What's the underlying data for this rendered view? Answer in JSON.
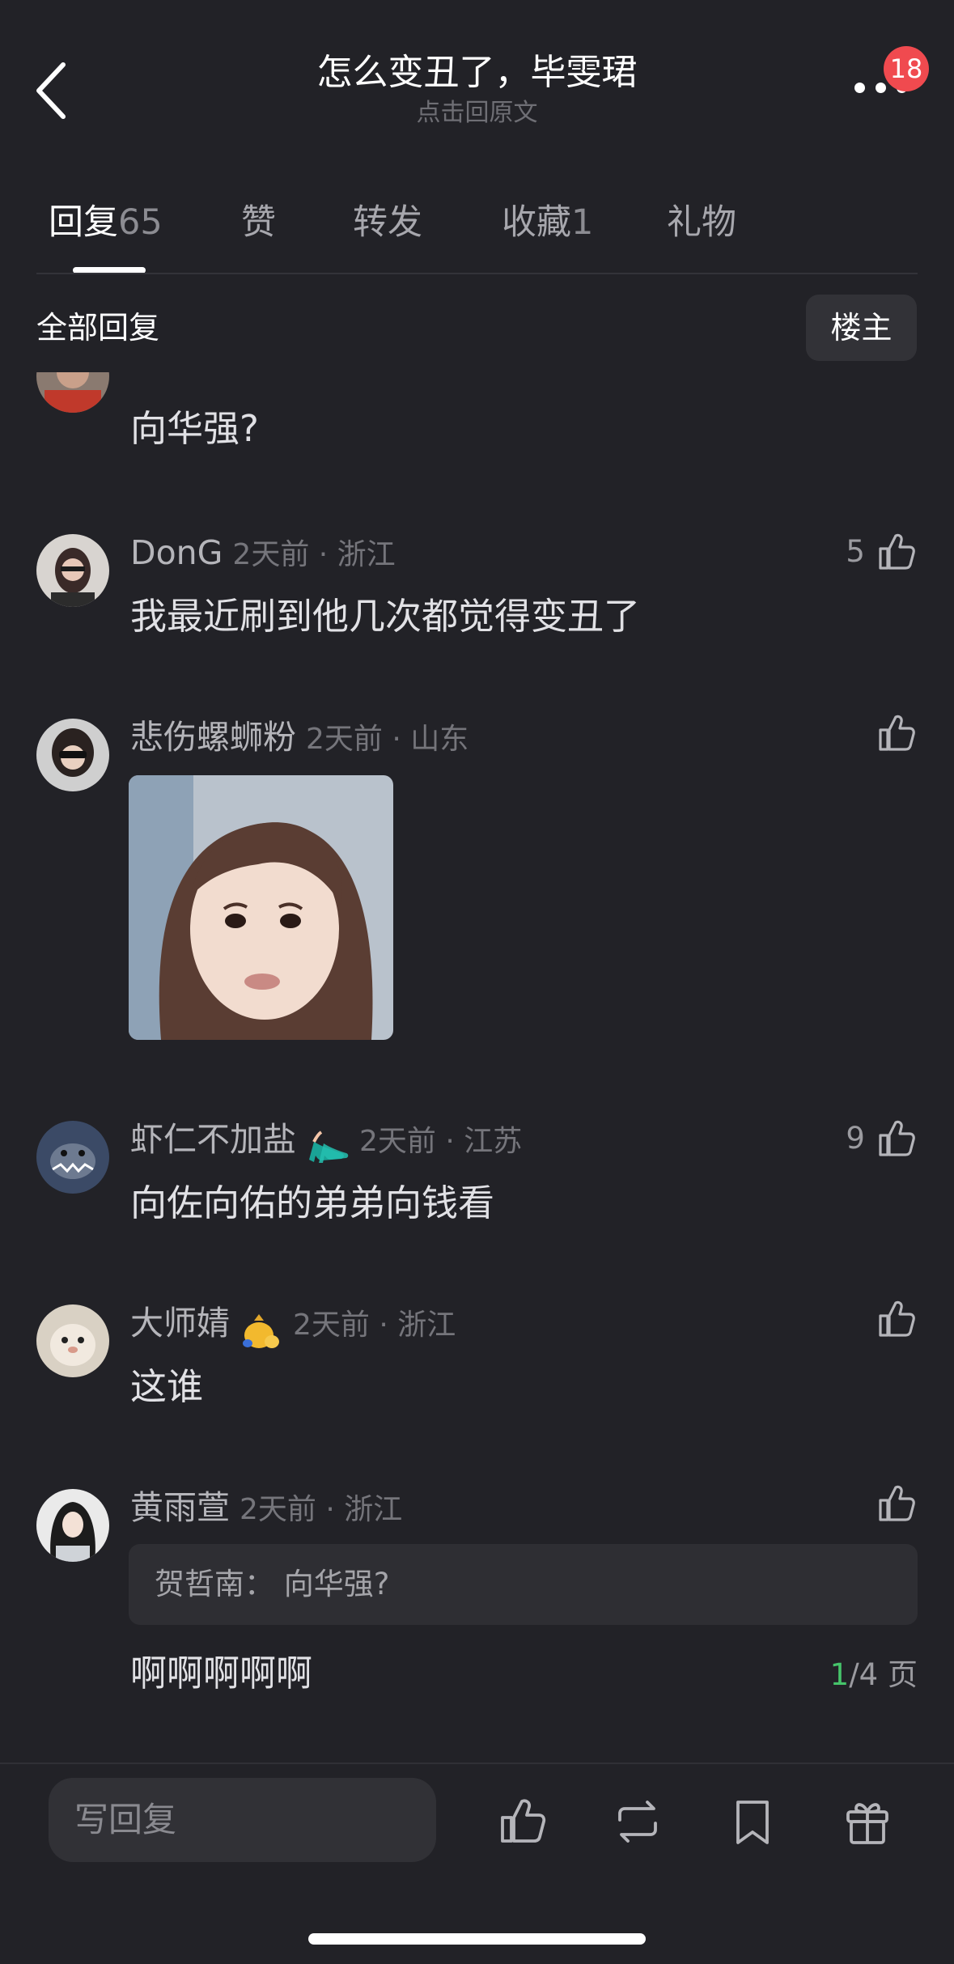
{
  "header": {
    "title": "怎么变丑了，毕雯珺",
    "subtitle": "点击回原文",
    "badge_count": "18",
    "back_icon": "chevron-left-icon",
    "more_icon": "more-dots-icon"
  },
  "tabs": [
    {
      "label": "回复",
      "count": "65"
    },
    {
      "label": "赞",
      "count": ""
    },
    {
      "label": "转发",
      "count": ""
    },
    {
      "label": "收藏",
      "count": "1"
    },
    {
      "label": "礼物",
      "count": ""
    }
  ],
  "filter": {
    "label": "全部回复",
    "owner_button": "楼主"
  },
  "comments": [
    {
      "text": "向华强?"
    },
    {
      "username": "DonG",
      "time": "2天前 · 浙江",
      "likes": "5",
      "text": "我最近刷到他几次都觉得变丑了"
    },
    {
      "username": "悲伤螺蛳粉",
      "time": "2天前 · 山东",
      "likes": "",
      "image": "reaction-photo"
    },
    {
      "username": "虾仁不加盐",
      "medal": "high-heels-icon",
      "time": "2天前 · 江苏",
      "likes": "9",
      "text": "向佐向佑的弟弟向钱看"
    },
    {
      "username": "大师婧",
      "medal": "money-bag-icon",
      "time": "2天前 · 浙江",
      "likes": "",
      "text": "这谁"
    },
    {
      "username": "黄雨萱",
      "time": "2天前 · 浙江",
      "likes": "",
      "quote": "贺哲南：  向华强?",
      "text": "啊啊啊啊啊"
    }
  ],
  "pager": {
    "current": "1",
    "total": "/4 页"
  },
  "bottom_bar": {
    "reply_placeholder": "写回复",
    "icons": [
      "thumbs-up-icon",
      "repost-icon",
      "bookmark-icon",
      "gift-icon"
    ]
  },
  "colors": {
    "background": "#222227",
    "badge": "#f04a4f",
    "pager_current": "#46c46a"
  }
}
